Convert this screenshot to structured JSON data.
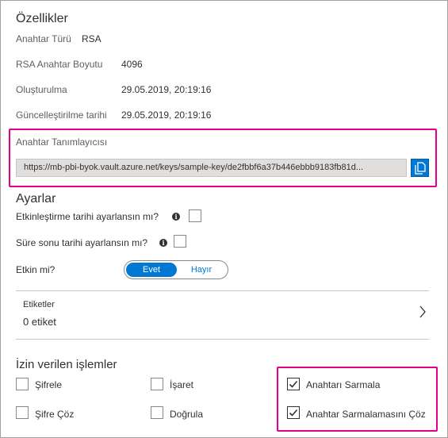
{
  "properties": {
    "title": "Özellikler",
    "key_type_label": "Anahtar Türü",
    "key_type_value": "RSA",
    "rsa_size_label": "RSA Anahtar Boyutu",
    "rsa_size_value": "4096",
    "created_label": "Oluşturulma",
    "created_value": "29.05.2019, 20:19:16",
    "updated_label": "Güncelleştirilme tarihi",
    "updated_value": "29.05.2019, 20:19:16",
    "key_identifier_label": "Anahtar Tanımlayıcısı",
    "key_identifier_value": "https://mb-pbi-byok.vault.azure.net/keys/sample-key/de2fbbf6a37b446ebbb9183fb81d..."
  },
  "settings": {
    "title": "Ayarlar",
    "activation_label": "Etkinleştirme tarihi ayarlansın mı?",
    "expiry_label": "Süre sonu tarihi ayarlansın mı?",
    "enabled_label": "Etkin mi?",
    "enabled_yes": "Evet",
    "enabled_no": "Hayır",
    "enabled_value": "Evet"
  },
  "tags": {
    "label": "Etiketler",
    "value": "0 etiket"
  },
  "operations": {
    "title": "İzin verilen işlemler",
    "encrypt": {
      "label": "Şifrele",
      "checked": false
    },
    "decrypt": {
      "label": "Şifre Çöz",
      "checked": false
    },
    "sign": {
      "label": "İşaret",
      "checked": false
    },
    "verify": {
      "label": "Doğrula",
      "checked": false
    },
    "wrap_key": {
      "label": "Anahtarı Sarmala",
      "checked": true
    },
    "unwrap_key": {
      "label": "Anahtar Sarmalamasını Çöz",
      "checked": true
    }
  },
  "colors": {
    "accent": "#0078d4",
    "highlight": "#e3008c"
  },
  "icons": {
    "copy": "copy-icon",
    "info": "info-icon",
    "chevron": "chevron-right-icon",
    "check": "checkmark-icon"
  }
}
